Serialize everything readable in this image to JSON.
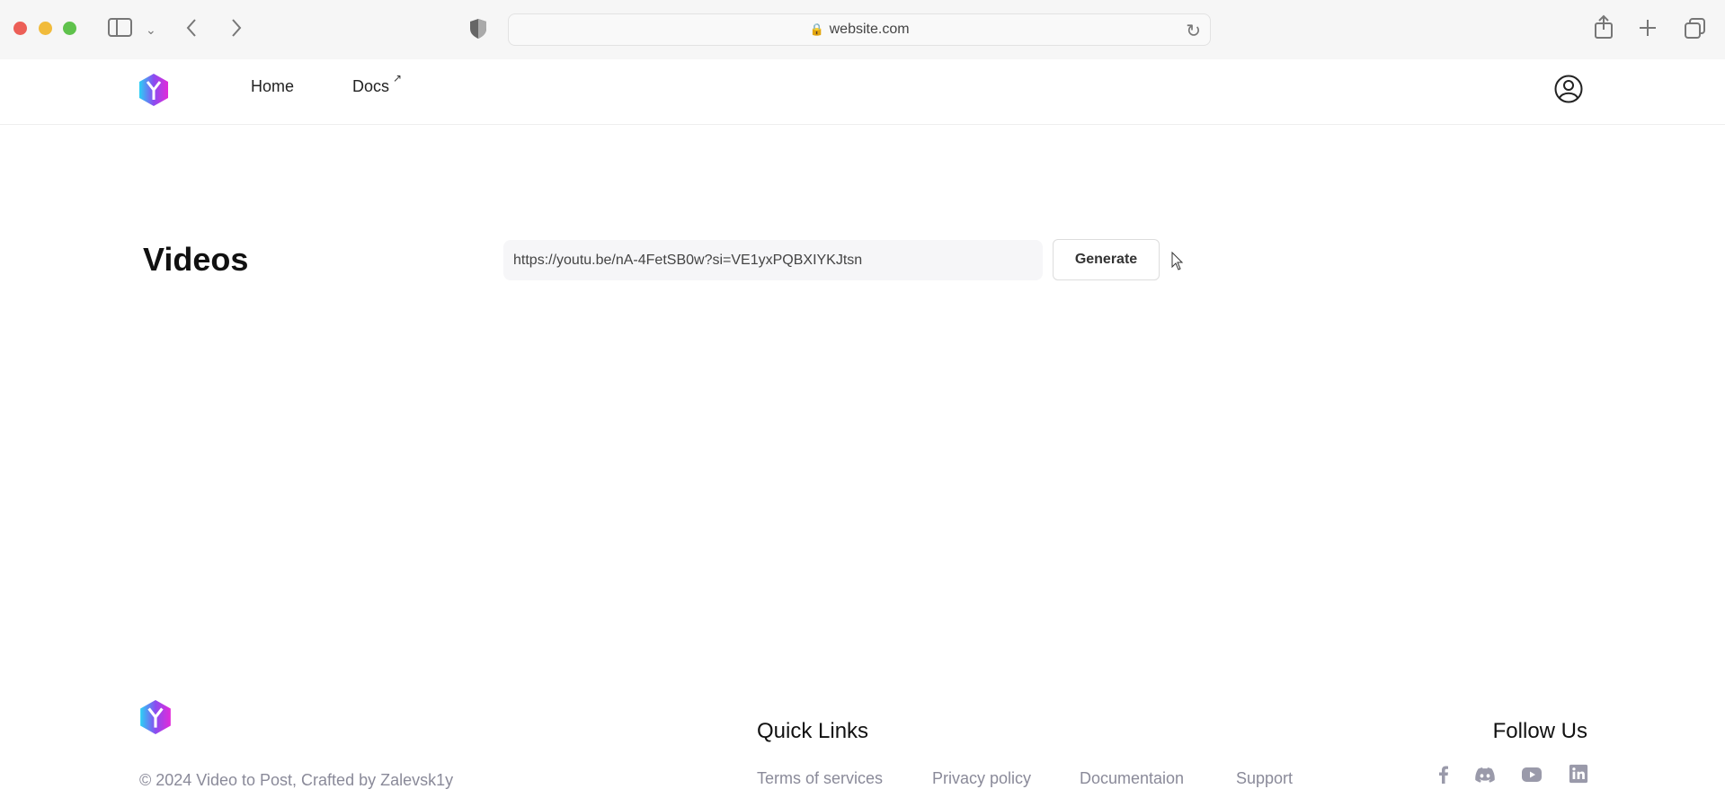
{
  "browser": {
    "url": "website.com"
  },
  "nav": {
    "home": "Home",
    "docs": "Docs"
  },
  "main": {
    "title": "Videos",
    "url_input_value": "https://youtu.be/nA-4FetSB0w?si=VE1yxPQBXIYKJtsn",
    "generate_label": "Generate"
  },
  "footer": {
    "copyright": "© 2024 Video to Post, Crafted by Zalevsk1y",
    "quick_links_title": "Quick Links",
    "links": [
      "Terms of services",
      "Privacy policy",
      "Documentaion",
      "Support"
    ],
    "follow_title": "Follow Us",
    "social_icons": [
      "facebook-icon",
      "discord-icon",
      "youtube-icon",
      "linkedin-icon"
    ],
    "link_color": "#8a8a99"
  }
}
